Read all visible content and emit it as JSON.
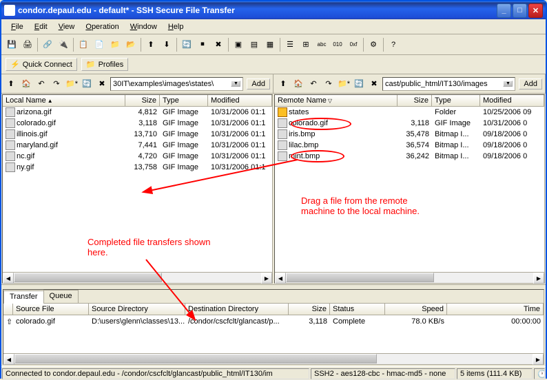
{
  "title": "condor.depaul.edu - default* - SSH Secure File Transfer",
  "menu": [
    "File",
    "Edit",
    "View",
    "Operation",
    "Window",
    "Help"
  ],
  "quick": {
    "connect": "Quick Connect",
    "profiles": "Profiles"
  },
  "nav": {
    "local_path": "30IT\\examples\\images\\states\\",
    "remote_path": "cast/public_html/IT130/images",
    "add": "Add"
  },
  "local": {
    "cols": [
      "Local Name",
      "Size",
      "Type",
      "Modified"
    ],
    "rows": [
      {
        "name": "arizona.gif",
        "size": "4,812",
        "type": "GIF Image",
        "mod": "10/31/2006 01:1"
      },
      {
        "name": "colorado.gif",
        "size": "3,118",
        "type": "GIF Image",
        "mod": "10/31/2006 01:1"
      },
      {
        "name": "illinois.gif",
        "size": "13,710",
        "type": "GIF Image",
        "mod": "10/31/2006 01:1"
      },
      {
        "name": "maryland.gif",
        "size": "7,441",
        "type": "GIF Image",
        "mod": "10/31/2006 01:1"
      },
      {
        "name": "nc.gif",
        "size": "4,720",
        "type": "GIF Image",
        "mod": "10/31/2006 01:1"
      },
      {
        "name": "ny.gif",
        "size": "13,758",
        "type": "GIF Image",
        "mod": "10/31/2006 01:1"
      }
    ]
  },
  "remote": {
    "cols": [
      "Remote Name",
      "Size",
      "Type",
      "Modified"
    ],
    "rows": [
      {
        "name": "states",
        "size": "",
        "type": "Folder",
        "mod": "10/25/2006 09",
        "folder": true
      },
      {
        "name": "colorado.gif",
        "size": "3,118",
        "type": "GIF Image",
        "mod": "10/31/2006 0"
      },
      {
        "name": "iris.bmp",
        "size": "35,478",
        "type": "Bitmap I...",
        "mod": "09/18/2006 0"
      },
      {
        "name": "lilac.bmp",
        "size": "36,574",
        "type": "Bitmap I...",
        "mod": "09/18/2006 0"
      },
      {
        "name": "mint.bmp",
        "size": "36,242",
        "type": "Bitmap I...",
        "mod": "09/18/2006 0"
      }
    ]
  },
  "transfer": {
    "tabs": [
      "Transfer",
      "Queue"
    ],
    "cols": [
      "Source File",
      "Source Directory",
      "Destination Directory",
      "Size",
      "Status",
      "Speed",
      "Time"
    ],
    "rows": [
      {
        "src": "colorado.gif",
        "srcdir": "D:\\users\\glenn\\classes\\13...",
        "dstdir": "/condor/cscfclt/glancast/p...",
        "size": "3,118",
        "status": "Complete",
        "speed": "78.0 KB/s",
        "time": "00:00:00"
      }
    ]
  },
  "status": {
    "left": "Connected to condor.depaul.edu - /condor/cscfclt/glancast/public_html/IT130/im",
    "mid": "SSH2 - aes128-cbc - hmac-md5 - none",
    "items": "5 items (111.4 KB)"
  },
  "annot": {
    "drag": "Drag a file from the remote\nmachine to the local machine.",
    "complete": "Completed file transfers shown\nhere."
  }
}
